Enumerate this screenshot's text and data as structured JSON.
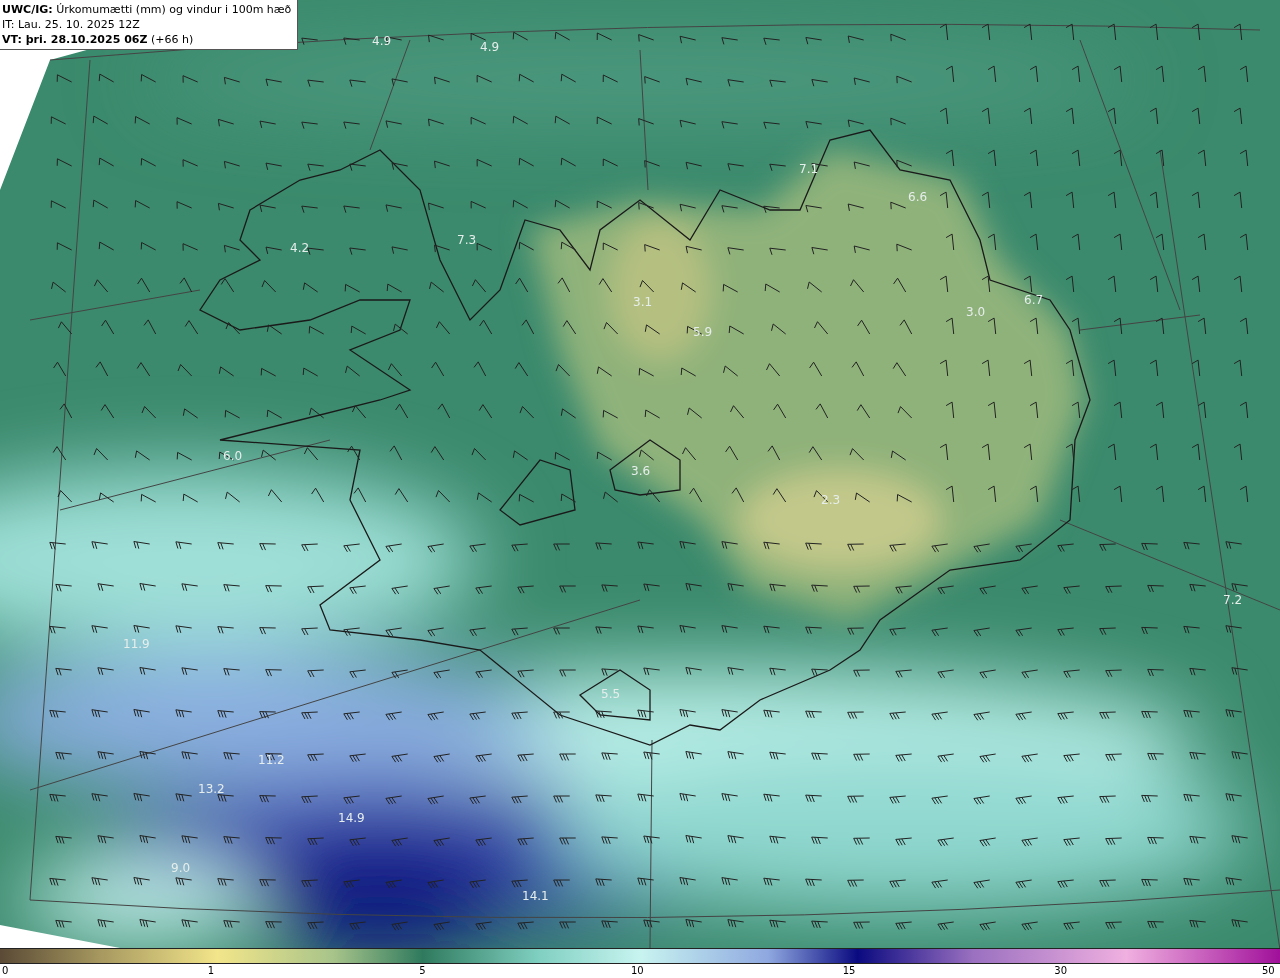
{
  "header": {
    "title": "**UWC/IG:** Úrkomumætti (mm) og vindur i 100m hæð",
    "init_time": "IT: Lau. 25. 10. 2025 12Z",
    "valid_time": "**VT: þri. 28.10.2025 06Z** (+66 h)"
  },
  "map_values": [
    "4.9",
    "4.9",
    "7.1",
    "6.6",
    "4.2",
    "7.3",
    "3.1",
    "5.9",
    "3.0",
    "6.7",
    "6.0",
    "3.6",
    "2.3",
    "7.2",
    "11.9",
    "5.5",
    "11.2",
    "13.2",
    "14.9",
    "9.0",
    "14.1"
  ],
  "colorbar": {
    "ticks": [
      "0",
      "1",
      "5",
      "10",
      "15",
      "30",
      "50"
    ]
  }
}
